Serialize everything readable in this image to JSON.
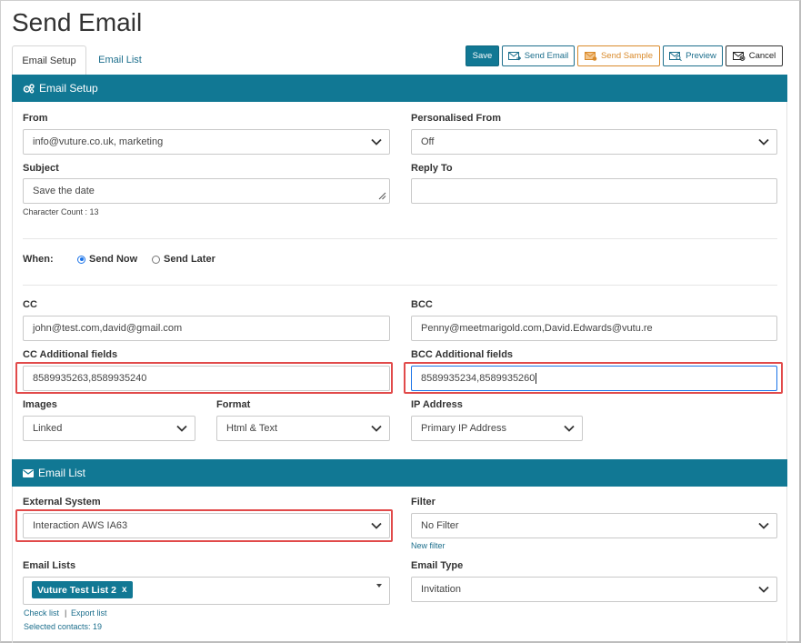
{
  "page": {
    "title": "Send Email"
  },
  "tabs": [
    {
      "label": "Email Setup"
    },
    {
      "label": "Email List"
    }
  ],
  "toolbar": {
    "save": "Save",
    "send_email": "Send Email",
    "send_sample": "Send Sample",
    "preview": "Preview",
    "cancel": "Cancel"
  },
  "email_setup": {
    "header": "Email Setup",
    "from_label": "From",
    "from_value": "info@vuture.co.uk, marketing",
    "personalised_from_label": "Personalised From",
    "personalised_from_value": "Off",
    "subject_label": "Subject",
    "subject_value": "Save the date",
    "character_count": "Character Count : 13",
    "reply_to_label": "Reply To",
    "reply_to_value": "",
    "when_label": "When:",
    "send_now": "Send Now",
    "send_later": "Send Later",
    "cc_label": "CC",
    "cc_value": "john@test.com,david@gmail.com",
    "bcc_label": "BCC",
    "bcc_value": "Penny@meetmarigold.com,David.Edwards@vutu.re",
    "cc_additional_label": "CC Additional fields",
    "cc_additional_value": "8589935263,8589935240",
    "bcc_additional_label": "BCC Additional fields",
    "bcc_additional_value": "8589935234,8589935260",
    "images_label": "Images",
    "images_value": "Linked",
    "format_label": "Format",
    "format_value": "Html & Text",
    "ip_label": "IP Address",
    "ip_value": "Primary IP Address"
  },
  "email_list": {
    "header": "Email List",
    "external_system_label": "External System",
    "external_system_value": "Interaction AWS IA63",
    "filter_label": "Filter",
    "filter_value": "No Filter",
    "new_filter": "New filter",
    "email_lists_label": "Email Lists",
    "list_tag": "Vuture Test List 2",
    "list_tag_remove": "x",
    "email_type_label": "Email Type",
    "email_type_value": "Invitation",
    "check_list": "Check list",
    "separator": "|",
    "export_list": "Export list",
    "selected_contacts": "Selected contacts: 19"
  },
  "colors": {
    "accent": "#117894",
    "highlight": "#e14a4a",
    "sample": "#d98a2b"
  }
}
